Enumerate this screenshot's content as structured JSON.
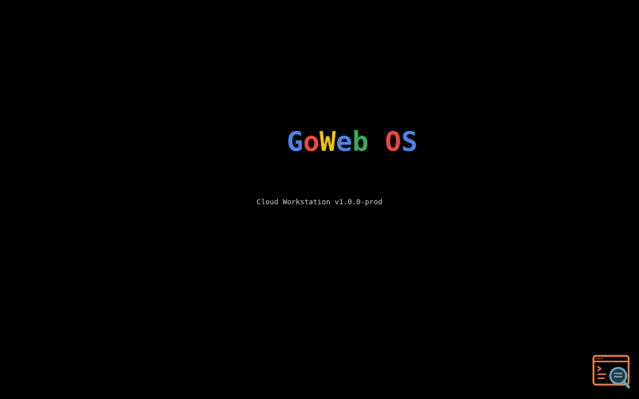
{
  "splash": {
    "title_letters": [
      {
        "char": "G",
        "color": "#4a86e8"
      },
      {
        "char": "o",
        "color": "#e94b3c"
      },
      {
        "char": "W",
        "color": "#f4c20d"
      },
      {
        "char": "e",
        "color": "#4a86e8"
      },
      {
        "char": "b",
        "color": "#3bab5a"
      },
      {
        "char": " ",
        "color": "#000000"
      },
      {
        "char": "O",
        "color": "#e94b3c"
      },
      {
        "char": "S",
        "color": "#4a86e8"
      }
    ],
    "subtitle": "Cloud Workstation v1.0.0-prod"
  },
  "dock": {
    "icon": "terminal-search-icon",
    "colors": {
      "frame": "#e07a4a",
      "lens": "#6aa8c0"
    }
  }
}
